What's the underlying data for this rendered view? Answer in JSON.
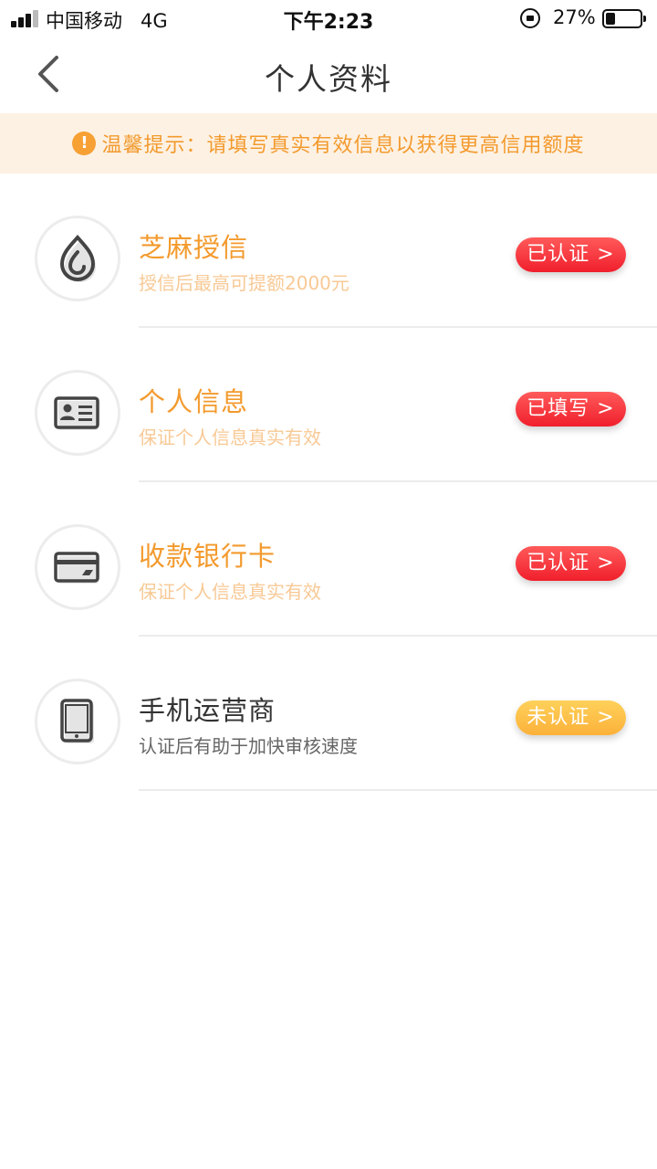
{
  "status_bar": {
    "carrier": "中国移动",
    "network": "4G",
    "time": "下午2:23",
    "battery_text": "27%",
    "battery_level": 0.27
  },
  "nav": {
    "title": "个人资料",
    "back_icon": "chevron-left-icon"
  },
  "tip": {
    "icon": "exclamation-circle-icon",
    "text": "温馨提示：请填写真实有效信息以获得更高信用额度"
  },
  "items": [
    {
      "icon": "sesame-drop-icon",
      "title": "芝麻授信",
      "subtitle": "授信后最高可提额2000元",
      "status": "已认证 >"
    },
    {
      "icon": "id-card-icon",
      "title": "个人信息",
      "subtitle": "保证个人信息真实有效",
      "status": "已填写 >"
    },
    {
      "icon": "bank-card-icon",
      "title": "收款银行卡",
      "subtitle": "保证个人信息真实有效",
      "status": "已认证 >"
    },
    {
      "icon": "mobile-phone-icon",
      "title": "手机运营商",
      "subtitle": "认证后有助于加快审核速度",
      "status": "未认证 >"
    }
  ],
  "colors": {
    "accent_orange": "#f39a2d",
    "subtitle_orange": "#f8c995",
    "badge_red": "#f01f2c",
    "badge_orange": "#fbb13a",
    "tip_bg": "#fdf1e3"
  }
}
